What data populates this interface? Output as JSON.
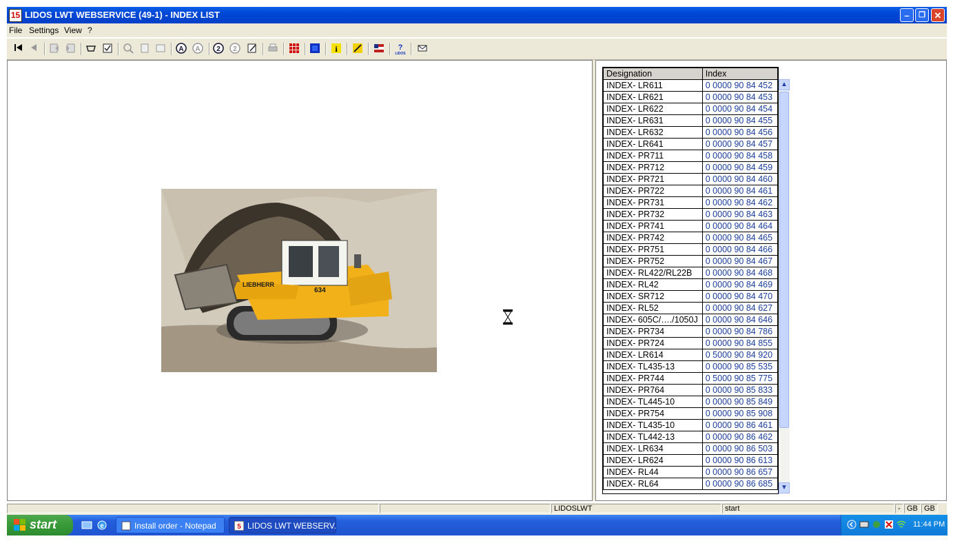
{
  "window": {
    "title": "LIDOS LWT WEBSERVICE (49-1) - INDEX LIST",
    "app_icon": "15"
  },
  "caption_buttons": {
    "minimize": "–",
    "maximize": "❐",
    "close": "✕"
  },
  "menu": [
    "File",
    "Settings",
    "View",
    "?"
  ],
  "toolbar_icons": [
    "first-record-icon",
    "previous-record-icon",
    "doc-back-icon",
    "doc-forward-icon",
    "basket-icon",
    "checklist-icon",
    "zoom-in-icon",
    "fit-page-icon",
    "fit-width-icon",
    "search-a-icon",
    "search-b-icon",
    "help-2-icon",
    "help-3-icon",
    "edit-note-icon",
    "print-icon",
    "grid-red-icon",
    "grid-blue-icon",
    "info-icon",
    "tools-icon",
    "flag-icon",
    "lidos-help-icon",
    "mail-icon"
  ],
  "table": {
    "columns": [
      "Designation",
      "Index"
    ],
    "rows": [
      [
        "INDEX- LR611",
        "0 0000 90 84 452"
      ],
      [
        "INDEX- LR621",
        "0 0000 90 84 453"
      ],
      [
        "INDEX- LR622",
        "0 0000 90 84 454"
      ],
      [
        "INDEX- LR631",
        "0 0000 90 84 455"
      ],
      [
        "INDEX- LR632",
        "0 0000 90 84 456"
      ],
      [
        "INDEX- LR641",
        "0 0000 90 84 457"
      ],
      [
        "INDEX- PR711",
        "0 0000 90 84 458"
      ],
      [
        "INDEX- PR712",
        "0 0000 90 84 459"
      ],
      [
        "INDEX- PR721",
        "0 0000 90 84 460"
      ],
      [
        "INDEX- PR722",
        "0 0000 90 84 461"
      ],
      [
        "INDEX- PR731",
        "0 0000 90 84 462"
      ],
      [
        "INDEX- PR732",
        "0 0000 90 84 463"
      ],
      [
        "INDEX- PR741",
        "0 0000 90 84 464"
      ],
      [
        "INDEX- PR742",
        "0 0000 90 84 465"
      ],
      [
        "INDEX- PR751",
        "0 0000 90 84 466"
      ],
      [
        "INDEX- PR752",
        "0 0000 90 84 467"
      ],
      [
        "INDEX- RL422/RL22B",
        "0 0000 90 84 468"
      ],
      [
        "INDEX- RL42",
        "0 0000 90 84 469"
      ],
      [
        "INDEX- SR712",
        "0 0000 90 84 470"
      ],
      [
        "INDEX- RL52",
        "0 0000 90 84 627"
      ],
      [
        "INDEX- 605C/…./1050J",
        "0 0000 90 84 646"
      ],
      [
        "INDEX- PR734",
        "0 0000 90 84 786"
      ],
      [
        "INDEX- PR724",
        "0 0000 90 84 855"
      ],
      [
        "INDEX- LR614",
        "0 5000 90 84 920"
      ],
      [
        "INDEX- TL435-13",
        "0 0000 90 85 535"
      ],
      [
        "INDEX- PR744",
        "0 5000 90 85 775"
      ],
      [
        "INDEX- PR764",
        "0 0000 90 85 833"
      ],
      [
        "INDEX- TL445-10",
        "0 0000 90 85 849"
      ],
      [
        "INDEX- PR754",
        "0 0000 90 85 908"
      ],
      [
        "INDEX- TL435-10",
        "0 0000 90 86 461"
      ],
      [
        "INDEX- TL442-13",
        "0 0000 90 86 462"
      ],
      [
        "INDEX- LR634",
        "0 0000 90 86 503"
      ],
      [
        "INDEX- LR624",
        "0 0000 90 86 613"
      ],
      [
        "INDEX- RL44",
        "0 0000 90 86 657"
      ],
      [
        "INDEX- RL64",
        "0 0000 90 86 685"
      ]
    ]
  },
  "photo": {
    "brand": "LIEBHERR",
    "model": "634"
  },
  "statusbar": {
    "panel3": "LIDOSLWT",
    "panel4": "start",
    "panel5": "-",
    "lang1": "GB",
    "lang2": "GB"
  },
  "taskbar": {
    "start": "start",
    "tasks": [
      "Install order - Notepad",
      "LIDOS LWT WEBSERV..."
    ],
    "clock": "11:44 PM"
  },
  "colors": {
    "titlebar": "#0047d6",
    "taskbar": "#245edb",
    "start": "#379a37",
    "index_text": "#1a3c9c"
  }
}
